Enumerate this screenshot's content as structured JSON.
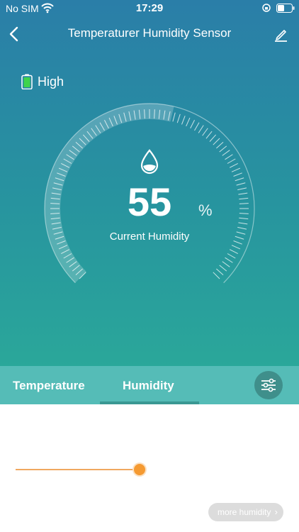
{
  "status_bar": {
    "carrier": "No SIM",
    "time": "17:29"
  },
  "nav": {
    "title": "Temperaturer Humidity Sensor"
  },
  "battery": {
    "level_label": "High",
    "color": "#3fd34b"
  },
  "gauge": {
    "value": "55",
    "unit": "%",
    "caption": "Current Humidity",
    "max": 100
  },
  "tabs": {
    "temperature": "Temperature",
    "humidity": "Humidity",
    "active": "humidity"
  },
  "slider": {
    "accent": "#f59a32"
  },
  "more_button": {
    "label": "more humidity"
  },
  "icons": {
    "back": "chevron-left-icon",
    "edit": "pencil-icon",
    "drop": "water-drop-icon",
    "settings": "sliders-icon",
    "wifi": "wifi-icon",
    "lock": "orientation-lock-icon",
    "status_battery": "battery-icon"
  }
}
